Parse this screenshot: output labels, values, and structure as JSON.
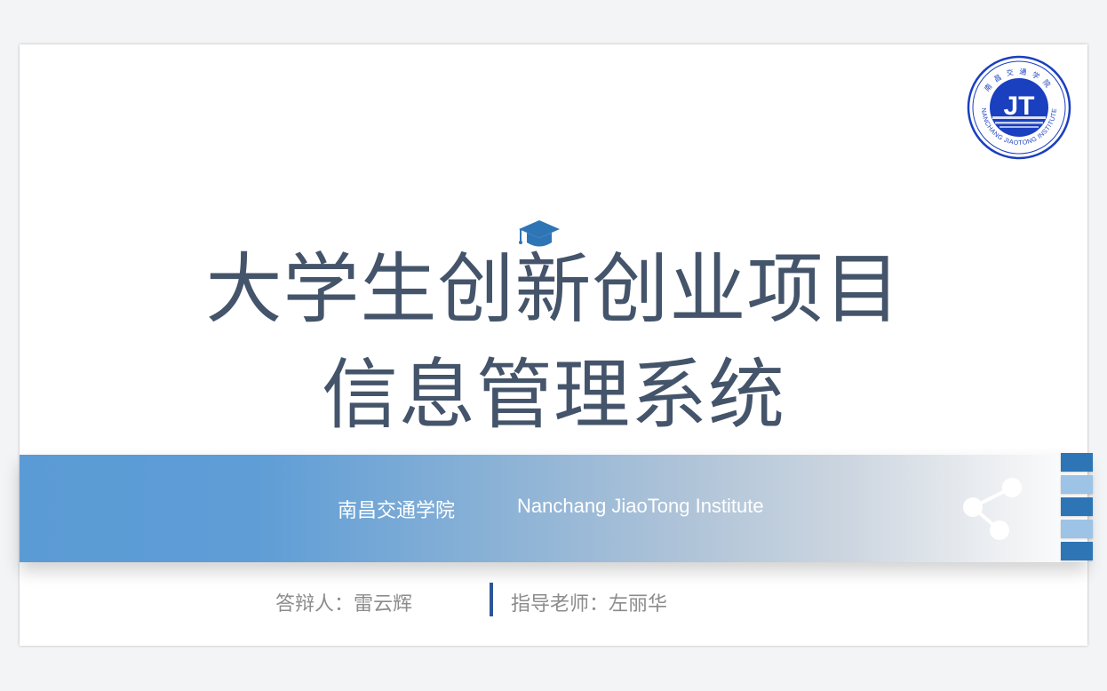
{
  "slide": {
    "title_line1": "大学生创新创业项目",
    "title_line2": "信息管理系统",
    "banner": {
      "school_cn": "南昌交通学院",
      "school_en": "Nanchang JiaoTong Institute"
    },
    "presenter": "答辩人：雷云辉",
    "advisor": "指导老师：左丽华",
    "logo": {
      "monogram": "JT",
      "ring_text": "NANCHANG JIAOTONG INSTITUTE",
      "ring_text_cn": "南昌交通学院"
    },
    "icons": {
      "title_decoration": "graduation-cap-icon",
      "banner": "share-icon"
    },
    "side_tabs": [
      "dark",
      "light",
      "dark",
      "light",
      "dark"
    ]
  },
  "colors": {
    "title": "#44546a",
    "banner_start": "#5b9bd5",
    "accent_dark": "#2e75b6",
    "accent_light": "#9dc3e6",
    "divider": "#2f5597",
    "footer_text": "#8c8c8c",
    "logo_blue": "#1a3fbf"
  }
}
